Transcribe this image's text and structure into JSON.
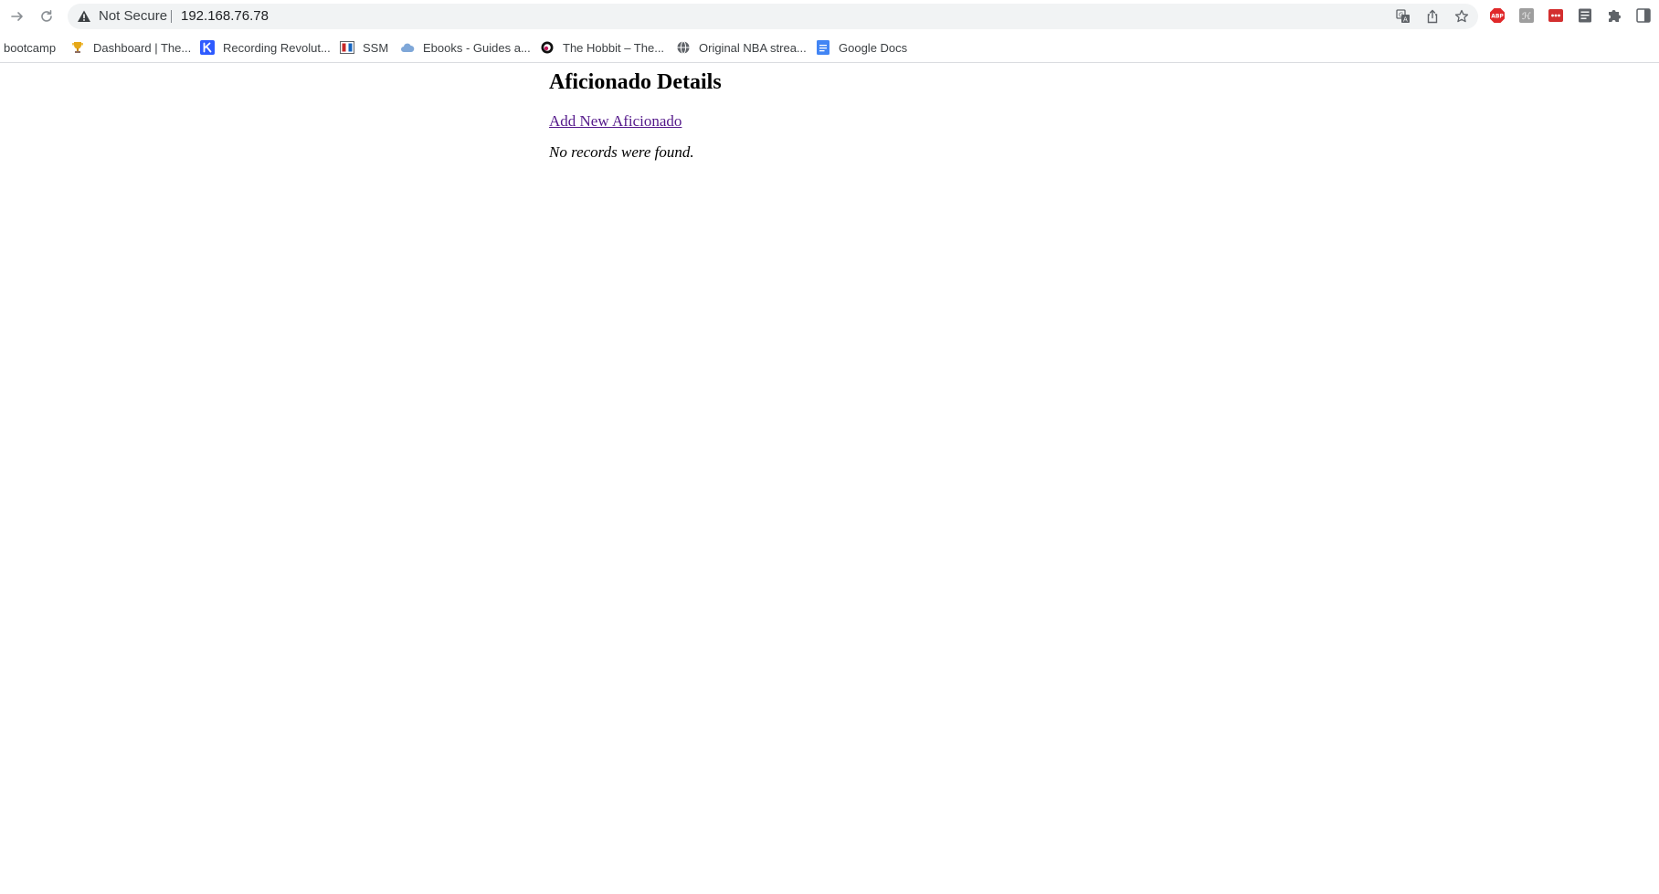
{
  "browser": {
    "security_label": "Not Secure",
    "url": "192.168.76.78",
    "icons": {
      "back": "back-arrow-icon",
      "reload": "reload-icon",
      "security": "warning-triangle-icon",
      "translate": "translate-icon",
      "share": "share-icon",
      "bookmark": "star-icon"
    },
    "extensions": [
      "adblock-plus-icon",
      "grey-extension-icon",
      "red-extension-icon",
      "reader-icon",
      "puzzle-icon",
      "side-panel-icon"
    ],
    "colors": {
      "omnibox": "#f1f3f4",
      "adblock": "#e0282a",
      "red_extension": "#d32f2f"
    }
  },
  "bookmarks": [
    {
      "label": "bootcamp",
      "icon": "none"
    },
    {
      "label": "Dashboard | The...",
      "icon": "trophy-icon"
    },
    {
      "label": "Recording Revolut...",
      "icon": "kajabi-icon"
    },
    {
      "label": "SSM",
      "icon": "ssm-icon"
    },
    {
      "label": "Ebooks - Guides a...",
      "icon": "cloud-icon"
    },
    {
      "label": "The Hobbit – The...",
      "icon": "circle-logo-icon"
    },
    {
      "label": "Original NBA strea...",
      "icon": "globe-icon"
    },
    {
      "label": "Google Docs",
      "icon": "google-docs-icon"
    }
  ],
  "page": {
    "title": "Aficionado Details",
    "add_link": "Add New Aficionado",
    "empty_message": "No records were found."
  }
}
